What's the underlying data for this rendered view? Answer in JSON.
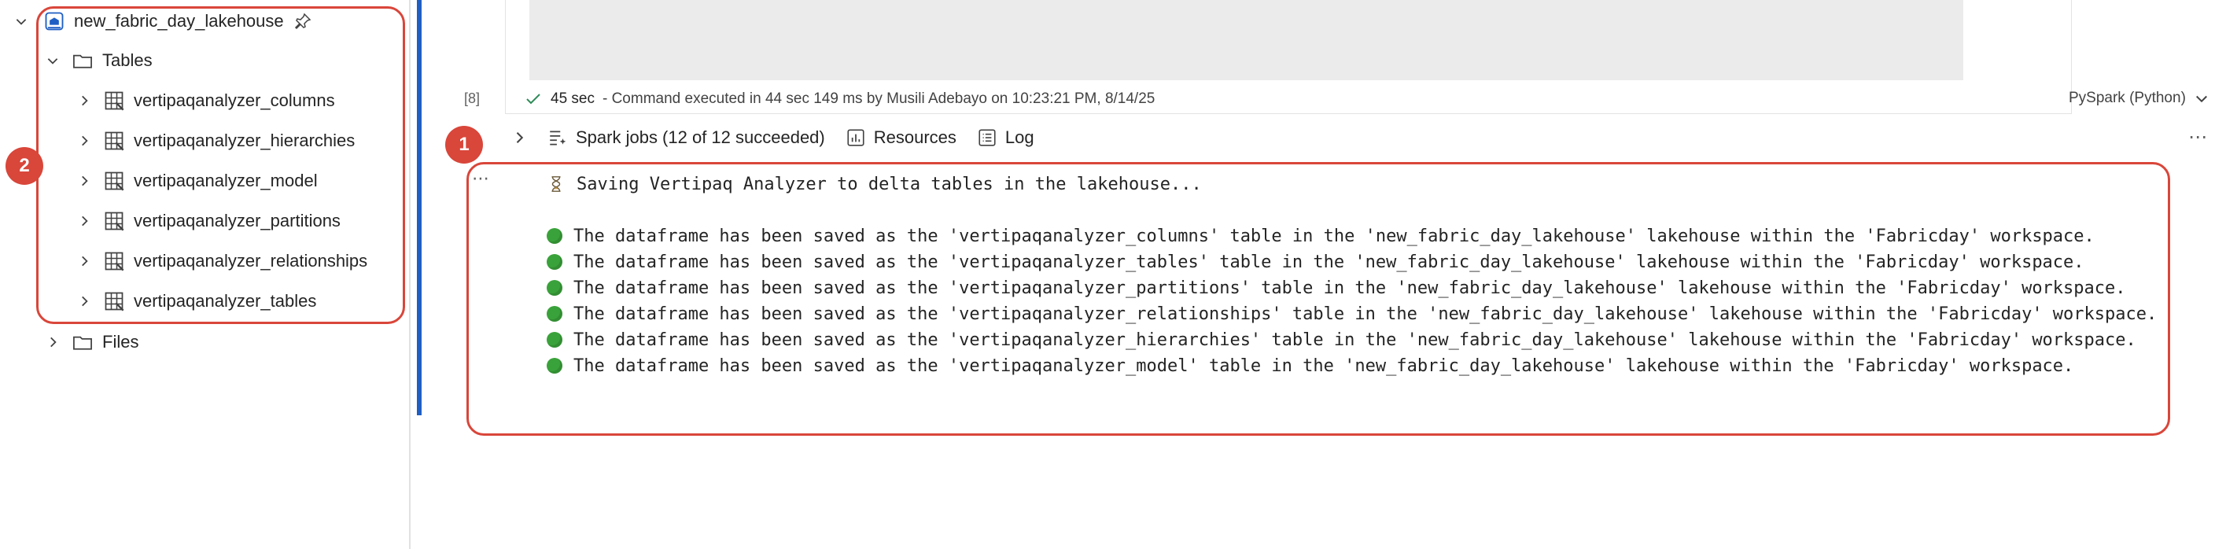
{
  "explorer": {
    "lakehouse": "new_fabric_day_lakehouse",
    "tables_label": "Tables",
    "tables": [
      "vertipaqanalyzer_columns",
      "vertipaqanalyzer_hierarchies",
      "vertipaqanalyzer_model",
      "vertipaqanalyzer_partitions",
      "vertipaqanalyzer_relationships",
      "vertipaqanalyzer_tables"
    ],
    "files_label": "Files",
    "marker": "2"
  },
  "cell": {
    "exec_count": "[8]",
    "duration": "45 sec",
    "status": "- Command executed in 44 sec 149 ms by Musili Adebayo on 10:23:21 PM, 8/14/25",
    "language": "PySpark (Python)",
    "marker": "1",
    "toolbar": {
      "spark_jobs": "Spark jobs (12 of 12 succeeded)",
      "resources": "Resources",
      "log": "Log"
    },
    "output": {
      "header": "Saving Vertipaq Analyzer to delta tables in the lakehouse...",
      "lines": [
        "The dataframe has been saved as the 'vertipaqanalyzer_columns' table in the 'new_fabric_day_lakehouse' lakehouse within the 'Fabricday' workspace.",
        "The dataframe has been saved as the 'vertipaqanalyzer_tables' table in the 'new_fabric_day_lakehouse' lakehouse within the 'Fabricday' workspace.",
        "The dataframe has been saved as the 'vertipaqanalyzer_partitions' table in the 'new_fabric_day_lakehouse' lakehouse within the 'Fabricday' workspace.",
        "The dataframe has been saved as the 'vertipaqanalyzer_relationships' table in the 'new_fabric_day_lakehouse' lakehouse within the 'Fabricday' workspace.",
        "The dataframe has been saved as the 'vertipaqanalyzer_hierarchies' table in the 'new_fabric_day_lakehouse' lakehouse within the 'Fabricday' workspace.",
        "The dataframe has been saved as the 'vertipaqanalyzer_model' table in the 'new_fabric_day_lakehouse' lakehouse within the 'Fabricday' workspace."
      ]
    }
  },
  "colors": {
    "accent": "#1f5fc4",
    "highlight": "#d9463a",
    "success": "#3aa23a"
  }
}
